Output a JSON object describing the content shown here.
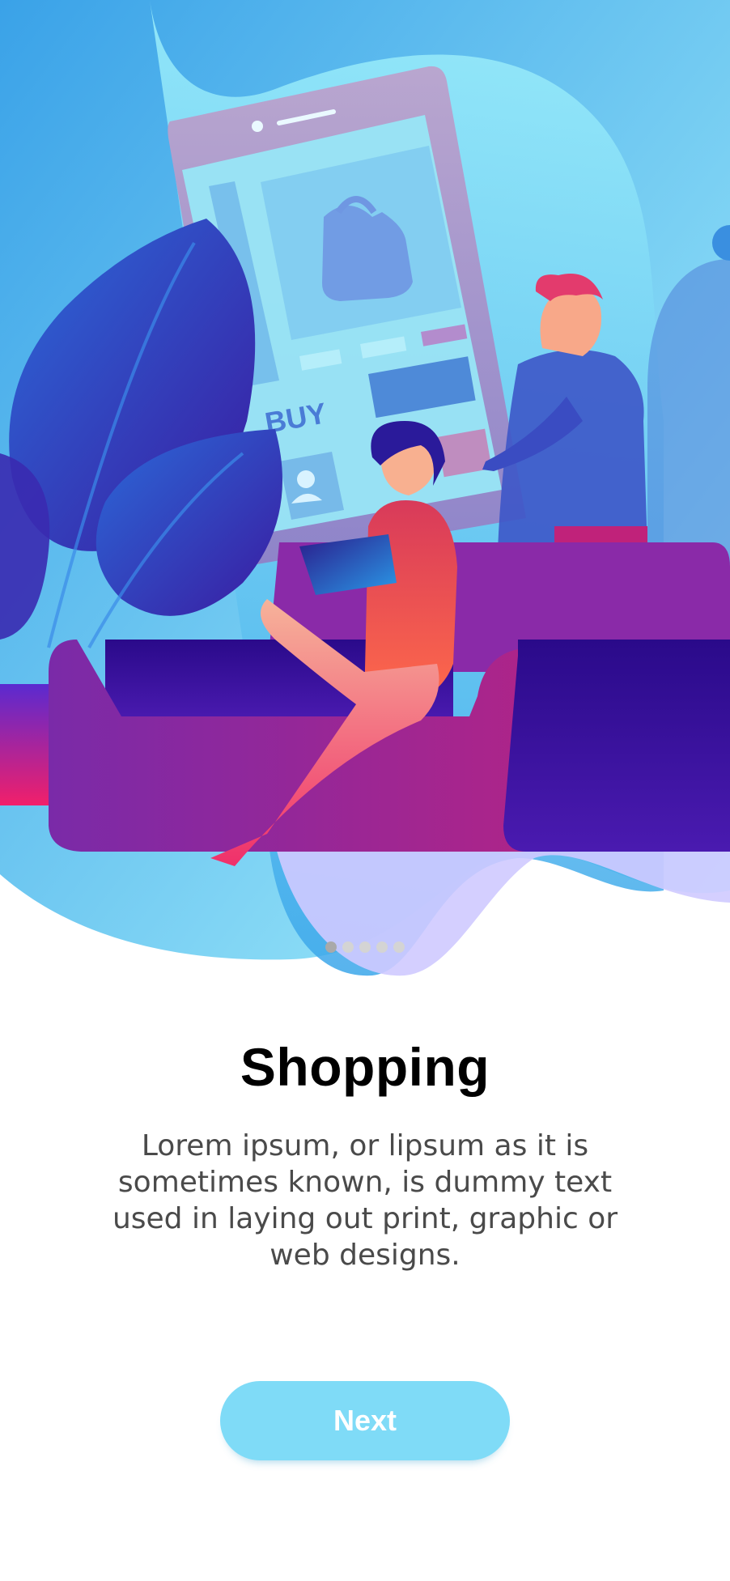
{
  "onboarding": {
    "title": "Shopping",
    "description": "Lorem ipsum, or lipsum as it is sometimes known, is dummy text used in laying out print, graphic or web designs.",
    "next_label": "Next",
    "pagination": {
      "total": 5,
      "active_index": 0
    },
    "illustration": {
      "name": "online-shopping-illustration",
      "phone_button_text": "BUY",
      "icons": [
        "shopping-bag-icon",
        "user-icon"
      ]
    }
  },
  "colors": {
    "accent": "#7fdbf7",
    "dot_active": "#a9a9a9",
    "dot_inactive": "#d4d4d4",
    "title": "#000000",
    "body_text": "#4a4a4a"
  }
}
